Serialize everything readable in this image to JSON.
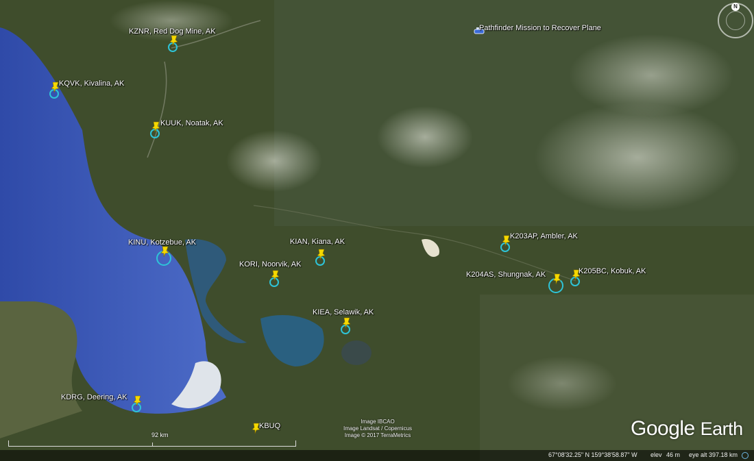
{
  "places": [
    {
      "id": "kznr",
      "label": "KZNR, Red Dog Mine, AK"
    },
    {
      "id": "kqvk",
      "label": "KQVK, Kivalina, AK"
    },
    {
      "id": "kuuk",
      "label": "KUUK, Noatak, AK"
    },
    {
      "id": "kinu",
      "label": "KINU, Kotzebue, AK"
    },
    {
      "id": "kian",
      "label": "KIAN, Kiana, AK"
    },
    {
      "id": "kori",
      "label": "KORI, Noorvik, AK"
    },
    {
      "id": "kiea",
      "label": "KIEA, Selawik, AK"
    },
    {
      "id": "k203ap",
      "label": "K203AP, Ambler, AK"
    },
    {
      "id": "k204as",
      "label": "K204AS, Shungnak, AK"
    },
    {
      "id": "k205bc",
      "label": "K205BC, Kobuk, AK"
    },
    {
      "id": "kdrg",
      "label": "KDRG, Deering, AK"
    },
    {
      "id": "kbuq",
      "label": "KBUQ"
    }
  ],
  "mission": {
    "label": "Pathfinder Mission to Recover Plane",
    "icon": "airplane-icon"
  },
  "credits": [
    "Image IBCAO",
    "Image Landsat / Copernicus",
    "Image © 2017 TerraMetrics"
  ],
  "logo": {
    "part1": "Google",
    "part2": "Earth"
  },
  "scale": {
    "label": "92 km"
  },
  "compass": {
    "north": "N"
  },
  "status": {
    "coords": "67°08'32.25\" N  159°38'58.87\" W",
    "elev_label": "elev",
    "elev_value": "46 m",
    "eye_alt": "eye alt 397.18 km"
  },
  "colors": {
    "pin": "#f5d800",
    "ring": "#2ec4d8",
    "water": "#3a59b8"
  }
}
